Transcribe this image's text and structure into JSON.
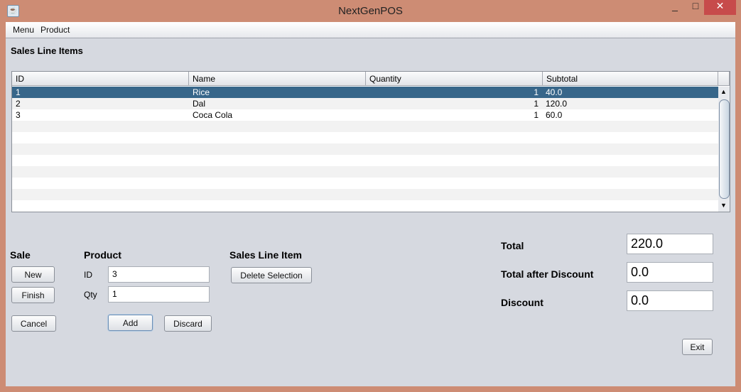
{
  "window": {
    "title": "NextGenPOS",
    "minimize": "_",
    "maximize": "□",
    "close": "✕"
  },
  "menu": [
    "Menu",
    "Product"
  ],
  "section_title": "Sales Line Items",
  "table": {
    "columns": [
      "ID",
      "Name",
      "Quantity",
      "Subtotal"
    ],
    "rows": [
      [
        "1",
        "Rice",
        "1",
        "40.0"
      ],
      [
        "2",
        "Dal",
        "1",
        "120.0"
      ],
      [
        "3",
        "Coca Cola",
        "1",
        "60.0"
      ]
    ],
    "selected_row": 0,
    "colors": {
      "selected": "#37668a"
    }
  },
  "sale": {
    "label": "Sale",
    "new": "New",
    "finish": "Finish",
    "cancel": "Cancel"
  },
  "product": {
    "label": "Product",
    "id_label": "ID",
    "id_value": "3",
    "qty_label": "Qty",
    "qty_value": "1",
    "add": "Add",
    "discard": "Discard"
  },
  "line_item": {
    "label": "Sales Line Item",
    "delete": "Delete Selection"
  },
  "totals": {
    "total_label": "Total",
    "total_value": "220.0",
    "after_label": "Total after Discount",
    "after_value": "0.0",
    "discount_label": "Discount",
    "discount_value": "0.0"
  },
  "exit": "Exit"
}
